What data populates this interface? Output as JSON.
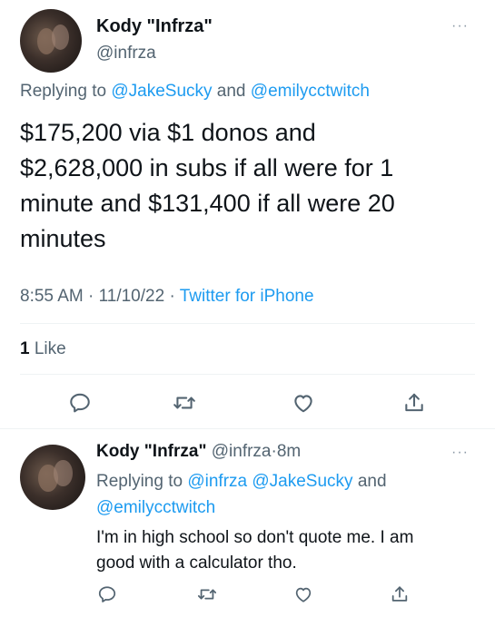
{
  "main_tweet": {
    "display_name": "Kody \"Infrza\"",
    "handle": "@infrza",
    "replying_prefix": "Replying to",
    "replying_user1": "@JakeSucky",
    "replying_and": "and",
    "replying_user2": "@emilycctwitch",
    "text_line1": "$175,200 via $1 donos and",
    "text_line2": "$2,628,000 in subs if all were for 1",
    "text_line3": "minute and $131,400 if all were 20",
    "text_line4": "minutes",
    "time": "8:55 AM",
    "dot1": "·",
    "date": "11/10/22",
    "dot2": "·",
    "source": "Twitter for iPhone",
    "like_count": "1",
    "like_label": "Like",
    "more_icon": "···"
  },
  "reply_tweet": {
    "display_name": "Kody \"Infrza\"",
    "handle": "@infrza",
    "dot": "·",
    "time_ago": "8m",
    "replying_prefix": "Replying to",
    "replying_user1": "@infrza",
    "replying_user2": "@JakeSucky",
    "replying_and": "and",
    "replying_user3": "@emilycctwitch",
    "text_line1": "I'm in high school so don't quote me. I am",
    "text_line2": "good with a calculator tho.",
    "more_icon": "···"
  },
  "icons": {
    "reply": "reply-icon",
    "retweet": "retweet-icon",
    "like": "heart-icon",
    "share": "share-icon",
    "more": "more-icon"
  },
  "colors": {
    "link": "#1d9bf0",
    "muted": "#536471",
    "text": "#0f1419",
    "divider": "#eff3f4"
  }
}
